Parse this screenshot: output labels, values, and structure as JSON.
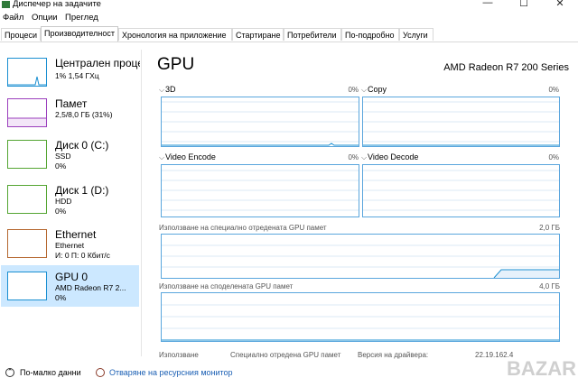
{
  "window": {
    "title": "Диспечер на задачите",
    "minimize": "—",
    "maximize": "☐",
    "close": "✕"
  },
  "menu": [
    "Файл",
    "Опции",
    "Преглед"
  ],
  "tabs": [
    "Процеси",
    "Производителност",
    "Хронология на приложение",
    "Стартиране",
    "Потребители",
    "По-подробно",
    "Услуги"
  ],
  "active_tab": 1,
  "sidebar": [
    {
      "name": "Централен процесор",
      "sub1": "1% 1,54 ГХц",
      "sub2": "",
      "color": "#1a8fd1"
    },
    {
      "name": "Памет",
      "sub1": "2,5/8,0 ГБ (31%)",
      "sub2": "",
      "color": "#9b3fbd"
    },
    {
      "name": "Диск 0 (C:)",
      "sub1": "SSD",
      "sub2": "0%",
      "color": "#54a532"
    },
    {
      "name": "Диск 1 (D:)",
      "sub1": "HDD",
      "sub2": "0%",
      "color": "#54a532"
    },
    {
      "name": "Ethernet",
      "sub1": "Ethernet",
      "sub2": "И: 0 П: 0 Кбит/с",
      "color": "#b5672f"
    },
    {
      "name": "GPU 0",
      "sub1": "AMD Radeon R7 2...",
      "sub2": "0%",
      "color": "#1a8fd1"
    }
  ],
  "selected_index": 5,
  "main": {
    "title": "GPU",
    "model": "AMD Radeon R7 200 Series",
    "engines": [
      {
        "label": "3D",
        "pct": "0%"
      },
      {
        "label": "Copy",
        "pct": "0%"
      },
      {
        "label": "Video Encode",
        "pct": "0%"
      },
      {
        "label": "Video Decode",
        "pct": "0%"
      }
    ],
    "dedicated_label": "Използване на специално отредената GPU памет",
    "dedicated_max": "2,0 ГБ",
    "shared_label": "Използване на споделената GPU памет",
    "shared_max": "4,0 ГБ",
    "stats": {
      "usage": "Използване",
      "dedicated": "Специално отредена GPU памет",
      "driver": "Версия на драйвера:",
      "driver_value": "22.19.162.4"
    }
  },
  "footer": {
    "less": "По-малко данни",
    "monitor": "Отваряне на ресурсния монитор"
  },
  "watermark": "BAZAR"
}
